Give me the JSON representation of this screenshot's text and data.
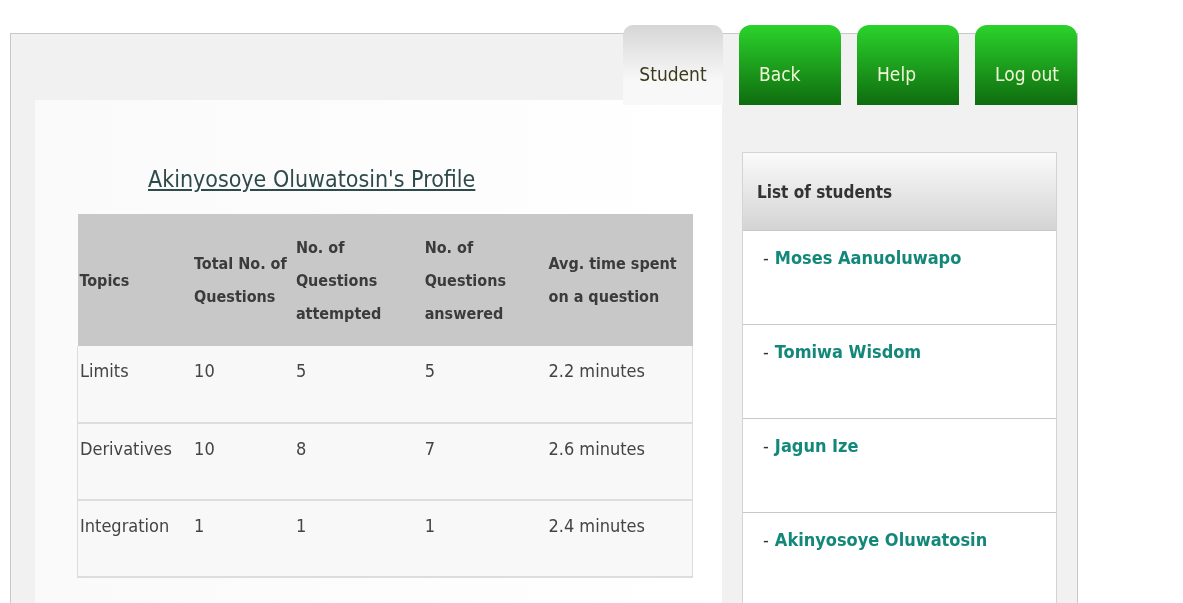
{
  "nav": [
    {
      "label": "Student",
      "kind": "tab",
      "selected": true
    },
    {
      "label": "Back",
      "kind": "button",
      "selected": false
    },
    {
      "label": "Help",
      "kind": "button",
      "selected": false
    },
    {
      "label": "Log out",
      "kind": "button",
      "selected": false
    }
  ],
  "profile": {
    "title": "Akinyosoye Oluwatosin's Profile",
    "table": {
      "columns": [
        "Topics",
        "Total No. of Questions",
        "No. of Questions attempted",
        "No. of Questions answered",
        "Avg. time spent on a question"
      ],
      "rows": [
        [
          "Limits",
          "10",
          "5",
          "5",
          "2.2 minutes"
        ],
        [
          "Derivatives",
          "10",
          "8",
          "7",
          "2.6 minutes"
        ],
        [
          "Integration",
          "1",
          "1",
          "1",
          "2.4 minutes"
        ]
      ]
    }
  },
  "sidebar": {
    "title": "List of students",
    "items": [
      {
        "bullet": "-",
        "name": "Moses Aanuoluwapo"
      },
      {
        "bullet": "-",
        "name": "Tomiwa Wisdom"
      },
      {
        "bullet": "-",
        "name": "Jagun Ize"
      },
      {
        "bullet": "-",
        "name": "Akinyosoye Oluwatosin"
      }
    ]
  }
}
